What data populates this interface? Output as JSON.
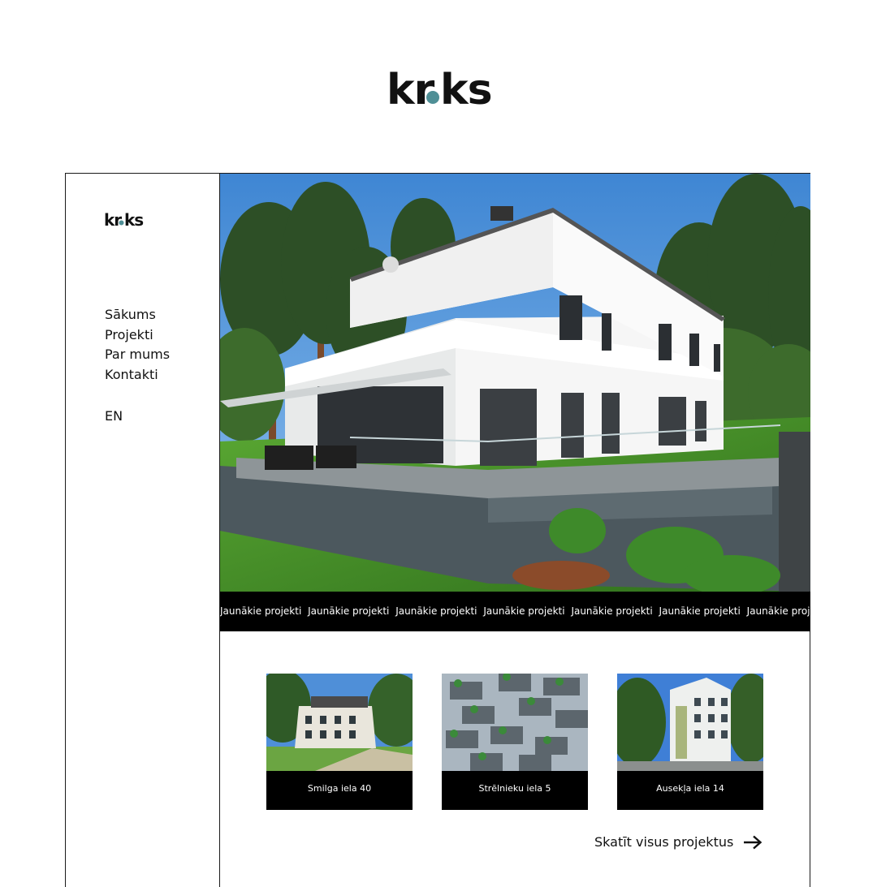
{
  "brand": {
    "logo_text": "kr.ks",
    "logo_prefix": "kr",
    "logo_suffix": "ks",
    "dot_color": "#4f8f96"
  },
  "sidebar": {
    "nav": [
      {
        "label": "Sākums"
      },
      {
        "label": "Projekti"
      },
      {
        "label": "Par mums"
      },
      {
        "label": "Kontakti"
      }
    ],
    "language": "EN"
  },
  "ticker": {
    "text": "Jaunākie projekti"
  },
  "projects": [
    {
      "title": "Smilga iela 40"
    },
    {
      "title": "Strēlnieku iela 5"
    },
    {
      "title": "Ausekļa iela 14"
    }
  ],
  "see_all": {
    "label": "Skatīt visus projektus"
  }
}
